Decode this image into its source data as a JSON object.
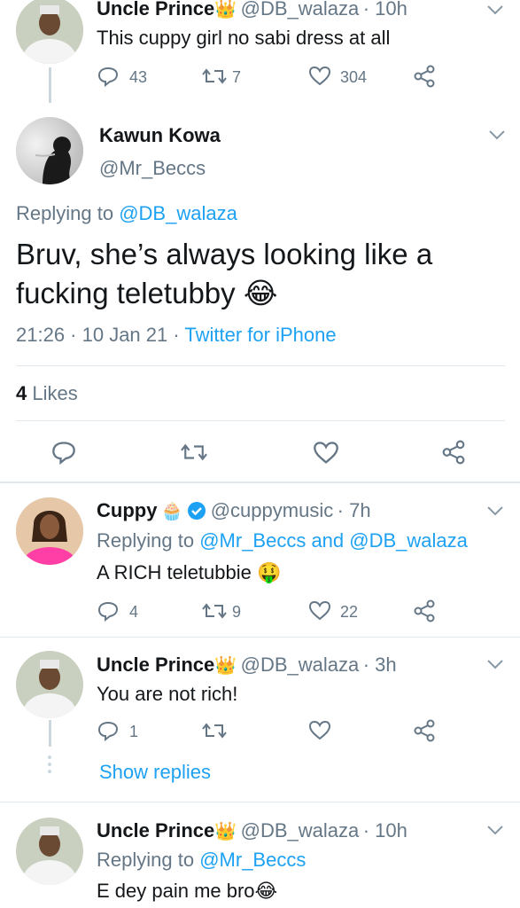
{
  "tweets": [
    {
      "name": "Uncle Prince",
      "handle": "@DB_walaza",
      "time": "· 10h",
      "text": "This cuppy girl no sabi dress at all",
      "replies": "43",
      "retweets": "7",
      "likes": "304"
    },
    {
      "name": "Cuppy",
      "handle": "@cuppymusic",
      "time": "· 7h",
      "replying_prefix": "Replying to",
      "replying_users": "@Mr_Beccs and @DB_walaza",
      "text": "A RICH teletubbie 🤑",
      "replies": "4",
      "retweets": "9",
      "likes": "22"
    },
    {
      "name": "Uncle Prince",
      "handle": "@DB_walaza",
      "time": "· 3h",
      "text": "You are not rich!",
      "replies": "1",
      "show_replies": "Show replies"
    },
    {
      "name": "Uncle Prince",
      "handle": "@DB_walaza",
      "time": "· 10h",
      "replying_prefix": "Replying to",
      "replying_users": "@Mr_Beccs",
      "text": "E dey pain me bro😂"
    }
  ],
  "focused": {
    "name": "Kawun Kowa",
    "handle": "@Mr_Beccs",
    "replying_prefix": "Replying to",
    "replying_user": "@DB_walaza",
    "text_line1": "Bruv, she’s always looking like a",
    "text_line2": "fucking teletubby 😂",
    "time": "21:26 · 10 Jan 21 ·",
    "source": "Twitter for iPhone",
    "likes_count": "4",
    "likes_label": "Likes"
  },
  "colors": {
    "link": "#1da1f2",
    "secondary": "#657786",
    "verified": "#1da1f2"
  },
  "icons": [
    "reply-icon",
    "retweet-icon",
    "like-icon",
    "share-icon",
    "chevron-down-icon",
    "verified-badge-icon",
    "crown-emoji"
  ]
}
